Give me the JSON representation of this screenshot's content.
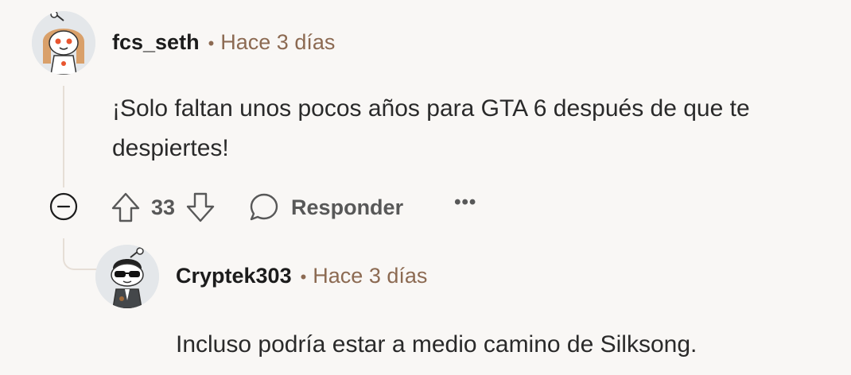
{
  "comments": [
    {
      "username": "fcs_seth",
      "time": "Hace 3 días",
      "separator": "•",
      "body": "¡Solo faltan unos pocos años para GTA 6 después de que te despiertes!",
      "votes": "33",
      "reply_label": "Responder",
      "more_label": "•••",
      "avatar_icon": "snoo-avatar-orange-hair"
    },
    {
      "username": "Cryptek303",
      "time": "Hace 3 días",
      "separator": "•",
      "body": "Incluso podría estar a medio camino de Silksong.",
      "avatar_icon": "snoo-avatar-sunglasses"
    }
  ],
  "icons": {
    "collapse": "minus-circle-icon",
    "upvote": "upvote-arrow-icon",
    "downvote": "downvote-arrow-icon",
    "reply": "speech-bubble-icon",
    "more": "ellipsis-icon"
  },
  "colors": {
    "background": "#f9f7f5",
    "meta_text": "#8c6a52",
    "body_text": "#2a2a2a",
    "action_text": "#585858",
    "thread_line": "#e6ded6"
  }
}
